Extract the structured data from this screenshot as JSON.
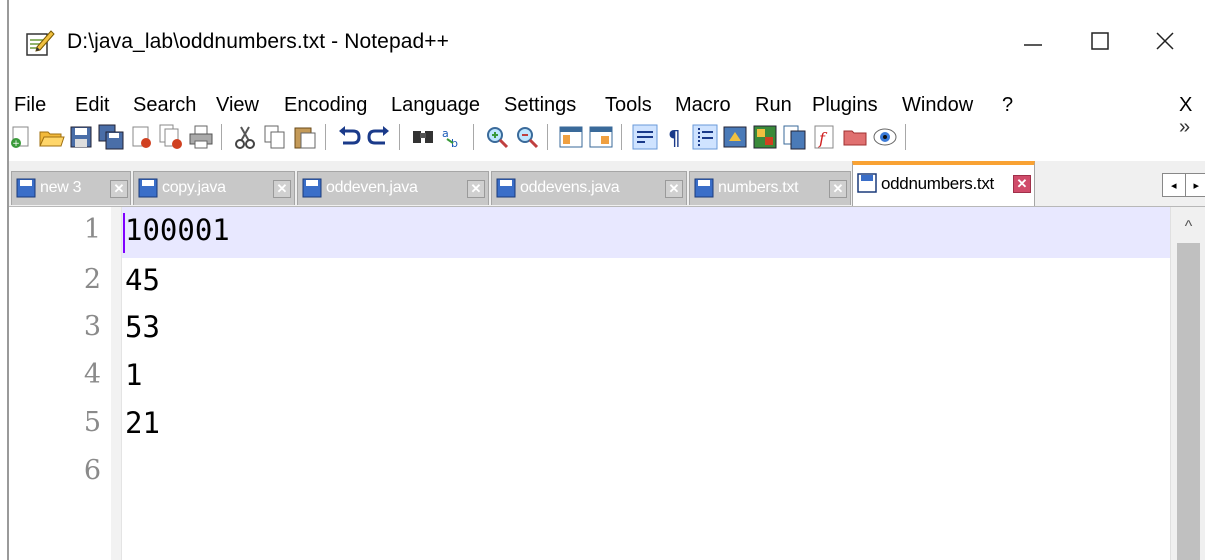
{
  "window": {
    "title": "D:\\java_lab\\oddnumbers.txt - Notepad++",
    "minimize_glyph": "—",
    "maximize_glyph": "☐",
    "close_glyph": "✕"
  },
  "menu": {
    "items": [
      "File",
      "Edit",
      "Search",
      "View",
      "Encoding",
      "Language",
      "Settings",
      "Tools",
      "Macro",
      "Run",
      "Plugins",
      "Window",
      "?"
    ],
    "close_label": "X"
  },
  "toolbar": {
    "icons": [
      "new-file-icon",
      "open-file-icon",
      "save-icon",
      "save-all-icon",
      "close-icon",
      "close-all-icon",
      "print-icon",
      "cut-icon",
      "copy-icon",
      "paste-icon",
      "undo-icon",
      "redo-icon",
      "find-icon",
      "replace-icon",
      "zoom-in-icon",
      "zoom-out-icon",
      "sync-vertical-icon",
      "sync-horizontal-icon",
      "word-wrap-icon",
      "show-all-chars-icon",
      "indent-guide-icon",
      "udl-icon",
      "doc-map-icon",
      "doc-list-icon",
      "function-list-icon",
      "folder-workspace-icon",
      "monitoring-icon"
    ],
    "overflow": "»"
  },
  "tabs": [
    {
      "label": "new 3",
      "active": false
    },
    {
      "label": "copy.java",
      "active": false
    },
    {
      "label": "oddeven.java",
      "active": false
    },
    {
      "label": "oddevens.java",
      "active": false
    },
    {
      "label": "numbers.txt",
      "active": false
    },
    {
      "label": "oddnumbers.txt",
      "active": true
    }
  ],
  "tab_close_glyph": "✕",
  "tab_scroll": {
    "left": "◂",
    "right": "▸"
  },
  "editor": {
    "lines": [
      "100001",
      "45",
      "53",
      "1",
      "21",
      ""
    ],
    "line_numbers": [
      "1",
      "2",
      "3",
      "4",
      "5",
      "6"
    ],
    "scroll_up_glyph": "^"
  },
  "colors": {
    "active_tab_accent": "#f9a233",
    "current_line": "#e8e8ff",
    "caret": "#8000ff",
    "tab_close_active": "#d04b6a"
  }
}
